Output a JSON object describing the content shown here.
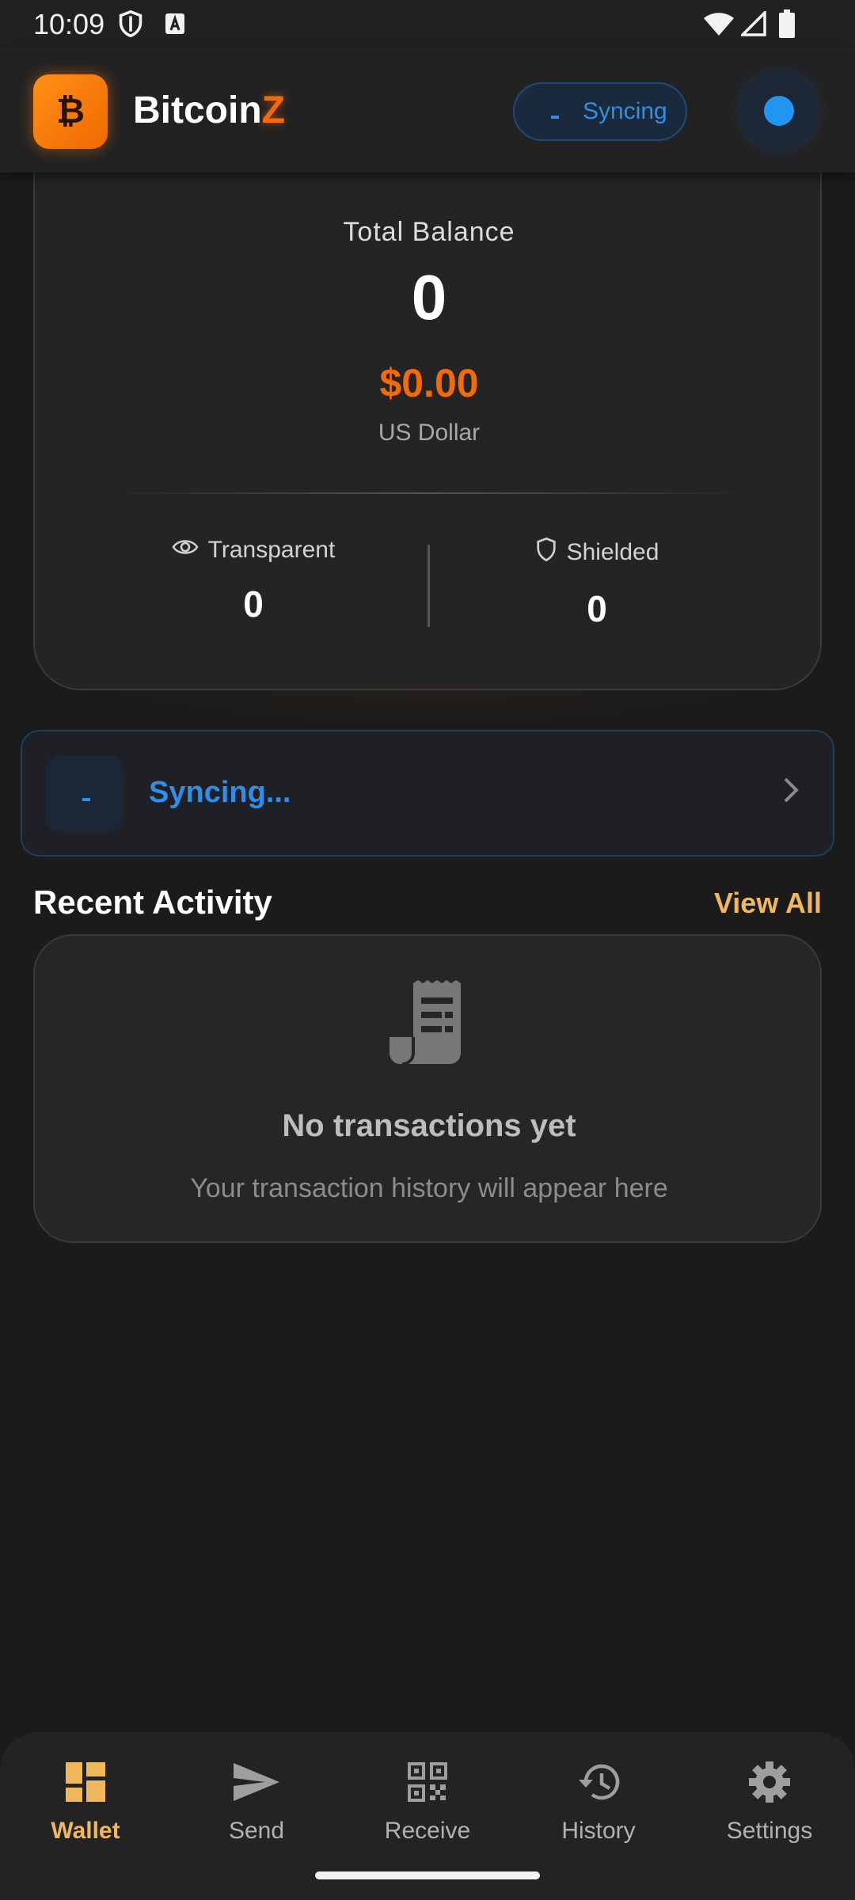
{
  "status_bar": {
    "time": "10:09"
  },
  "header": {
    "logo_glyph": "₿",
    "brand_prefix": "Bitcoin",
    "brand_suffix": "Z",
    "sync_label": "Syncing"
  },
  "balance": {
    "title": "Total Balance",
    "amount": "0",
    "fiat_amount": "$0.00",
    "fiat_currency": "US Dollar",
    "transparent_label": "Transparent",
    "transparent_value": "0",
    "shielded_label": "Shielded",
    "shielded_value": "0"
  },
  "sync_banner": {
    "text": "Syncing..."
  },
  "recent_activity": {
    "title": "Recent Activity",
    "view_all": "View All",
    "empty_title": "No transactions yet",
    "empty_subtitle": "Your transaction history will appear here"
  },
  "bottom_nav": [
    {
      "label": "Wallet",
      "icon": "dashboard-icon",
      "active": true
    },
    {
      "label": "Send",
      "icon": "send-icon",
      "active": false
    },
    {
      "label": "Receive",
      "icon": "qr-code-icon",
      "active": false
    },
    {
      "label": "History",
      "icon": "history-icon",
      "active": false
    },
    {
      "label": "Settings",
      "icon": "gear-icon",
      "active": false
    }
  ],
  "colors": {
    "accent": "#f26a0a",
    "sync_blue": "#2f8fe6",
    "nav_active": "#f0b85a",
    "background": "#1b1b1b"
  }
}
